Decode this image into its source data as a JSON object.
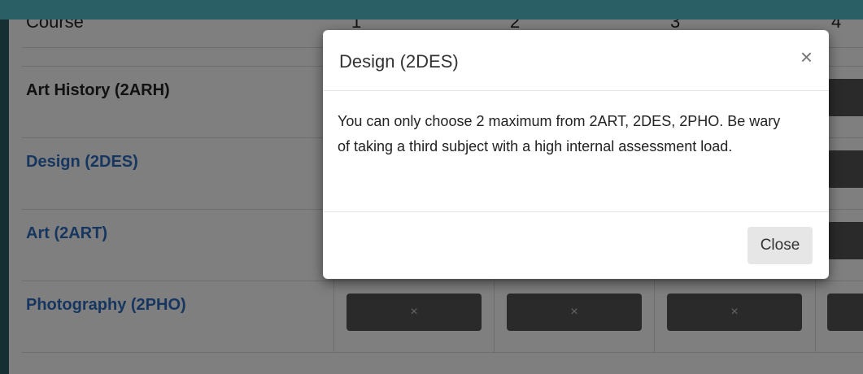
{
  "table": {
    "header": {
      "course": "Course",
      "cols": [
        "1",
        "2",
        "3",
        "4"
      ]
    },
    "rows": [
      {
        "name": "Art History (2ARH)",
        "link": false
      },
      {
        "name": "Design (2DES)",
        "link": true
      },
      {
        "name": "Art (2ART)",
        "link": true
      },
      {
        "name": "Photography (2PHO)",
        "link": true
      }
    ],
    "cell_button_symbol": "×"
  },
  "modal": {
    "title": "Design (2DES)",
    "close_symbol": "×",
    "body": "You can only choose 2 maximum from 2ART, 2DES, 2PHO. Be wary of taking a third subject with a high internal assessment load.",
    "close_label": "Close"
  },
  "colors": {
    "link": "#2d6cc0",
    "frame": "#2a5f66",
    "cell_button": "#555555"
  }
}
